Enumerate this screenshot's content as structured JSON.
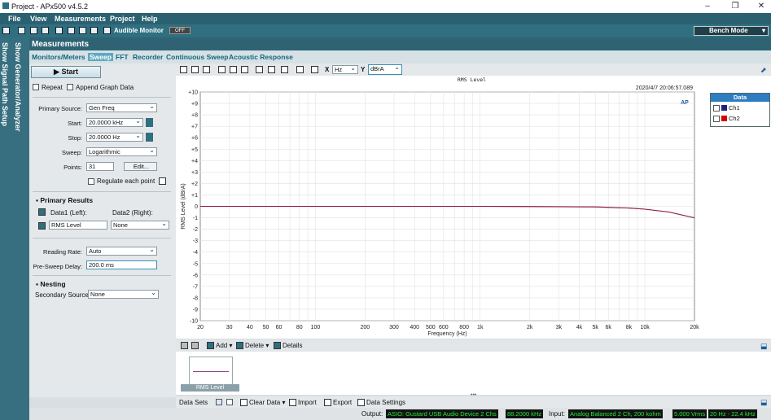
{
  "window": {
    "title": "Project - APx500 v4.5.2",
    "controls": [
      "–",
      "❐",
      "✕"
    ]
  },
  "menu": [
    "File",
    "View",
    "Measurements",
    "Project",
    "Help"
  ],
  "toolbar": {
    "audible_label": "Audible Monitor",
    "audible_state": "OFF",
    "mode_label": "Bench Mode"
  },
  "sidebar": {
    "show_setup": "Show Signal Path Setup",
    "show_gen": "Show Generator/Analyzer"
  },
  "header": {
    "title": "Measurements"
  },
  "tabs": [
    {
      "label": "Monitors/Meters",
      "active": false
    },
    {
      "label": "Sweep",
      "active": true
    },
    {
      "label": "FFT",
      "active": false
    },
    {
      "label": "Recorder",
      "active": false
    },
    {
      "label": "Continuous Sweep",
      "active": false
    },
    {
      "label": "Acoustic Response",
      "active": false
    }
  ],
  "left": {
    "start_label": "Start",
    "repeat_label": "Repeat",
    "append_label": "Append Graph Data",
    "primary_source_label": "Primary Source:",
    "primary_source_value": "Gen Freq",
    "start_field_label": "Start:",
    "start_value": "20.0000 kHz",
    "stop_label": "Stop:",
    "stop_value": "20.0000 Hz",
    "sweep_label": "Sweep:",
    "sweep_value": "Logarithmic",
    "points_label": "Points:",
    "points_value": "31",
    "edit_label": "Edit...",
    "regulate_label": "Regulate each point",
    "primary_results_title": "Primary Results",
    "data1_label": "Data1 (Left):",
    "data2_label": "Data2 (Right):",
    "data1_value": "RMS Level",
    "data2_value": "None",
    "reading_rate_label": "Reading Rate:",
    "reading_rate_value": "Auto",
    "pre_sweep_label": "Pre-Sweep Delay:",
    "pre_sweep_value": "200.0 ms",
    "nesting_title": "Nesting",
    "secondary_label": "Secondary Source:",
    "secondary_value": "None"
  },
  "graph_toolbar": {
    "x_label": "X",
    "x_unit": "Hz",
    "y_label": "Y",
    "y_unit": "dBrA"
  },
  "legend": {
    "title": "Data",
    "items": [
      {
        "name": "Ch1",
        "color": "#1a237e"
      },
      {
        "name": "Ch2",
        "color": "#d50000"
      }
    ]
  },
  "chart_data": {
    "type": "line",
    "title": "RMS Level",
    "timestamp": "2020/4/7 20:06:57.089",
    "xlabel": "Frequency (Hz)",
    "ylabel": "RMS Level (dBrA)",
    "x_scale": "log",
    "xlim": [
      20,
      20000
    ],
    "ylim": [
      -10,
      10
    ],
    "grid": true,
    "x_ticks": [
      {
        "v": 20,
        "t": "20"
      },
      {
        "v": 30,
        "t": "30"
      },
      {
        "v": 40,
        "t": "40"
      },
      {
        "v": 50,
        "t": "50"
      },
      {
        "v": 60,
        "t": "60"
      },
      {
        "v": 80,
        "t": "80"
      },
      {
        "v": 100,
        "t": "100"
      },
      {
        "v": 200,
        "t": "200"
      },
      {
        "v": 300,
        "t": "300"
      },
      {
        "v": 400,
        "t": "400"
      },
      {
        "v": 500,
        "t": "500"
      },
      {
        "v": 600,
        "t": "600"
      },
      {
        "v": 800,
        "t": "800"
      },
      {
        "v": 1000,
        "t": "1k"
      },
      {
        "v": 2000,
        "t": "2k"
      },
      {
        "v": 3000,
        "t": "3k"
      },
      {
        "v": 4000,
        "t": "4k"
      },
      {
        "v": 5000,
        "t": "5k"
      },
      {
        "v": 6000,
        "t": "6k"
      },
      {
        "v": 8000,
        "t": "8k"
      },
      {
        "v": 10000,
        "t": "10k"
      },
      {
        "v": 20000,
        "t": "20k"
      }
    ],
    "y_ticks": [
      "+10",
      "+9",
      "+8",
      "+7",
      "+6",
      "+5",
      "+4",
      "+3",
      "+2",
      "+1",
      "0",
      "-1",
      "-2",
      "-3",
      "-4",
      "-5",
      "-6",
      "-7",
      "-8",
      "-9",
      "-10"
    ],
    "series": [
      {
        "name": "Ch1",
        "color": "#1a237e",
        "x": [
          20,
          100,
          1000,
          5000,
          8000,
          10000,
          14000,
          20000
        ],
        "y": [
          0.0,
          0.0,
          0.0,
          -0.05,
          -0.15,
          -0.25,
          -0.5,
          -1.0
        ]
      },
      {
        "name": "Ch2",
        "color": "#d50000",
        "x": [
          20,
          100,
          1000,
          5000,
          8000,
          10000,
          14000,
          20000
        ],
        "y": [
          0.0,
          0.0,
          0.0,
          -0.05,
          -0.15,
          -0.25,
          -0.5,
          -1.0
        ]
      }
    ]
  },
  "lower": {
    "add_label": "Add",
    "delete_label": "Delete",
    "details_label": "Details",
    "thumb_label": "RMS Level"
  },
  "datasets": {
    "label": "Data Sets",
    "clear_label": "Clear Data",
    "import_label": "Import",
    "export_label": "Export",
    "settings_label": "Data Settings"
  },
  "status": {
    "output_label": "Output:",
    "output_device": "ASIO: Gustard USB Audio Device 2 Chs",
    "output_rate": "88.2000 kHz",
    "input_label": "Input:",
    "input_device": "Analog Balanced 2 Ch, 200 kohm",
    "input_range": "5.000 Vrms",
    "input_bw": "20 Hz - 22.4 kHz"
  }
}
